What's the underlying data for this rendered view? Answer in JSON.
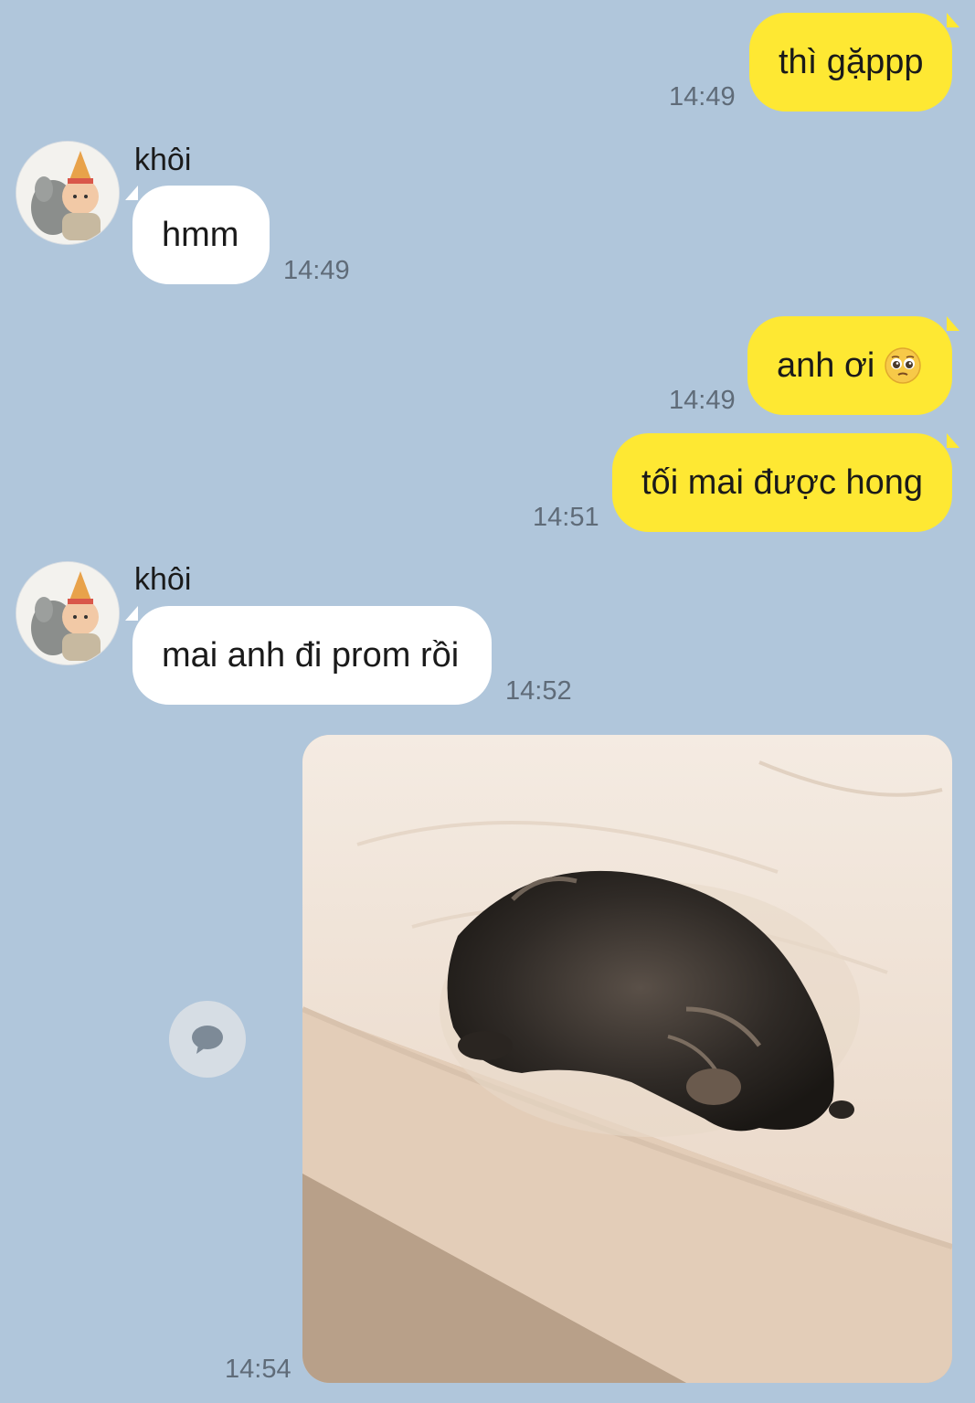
{
  "messages": [
    {
      "side": "me",
      "text": "thì gặppp",
      "time": "14:49"
    },
    {
      "side": "them",
      "sender": "khôi",
      "text": "hmm",
      "time": "14:49"
    },
    {
      "side": "me",
      "text": "anh ơi",
      "emoji": "pleading-face-icon",
      "time": "14:49"
    },
    {
      "side": "me",
      "text": "tối mai được hong",
      "time": "14:51"
    },
    {
      "side": "them",
      "sender": "khôi",
      "text": "mai anh đi prom rồi",
      "time": "14:52"
    },
    {
      "side": "me",
      "type": "image",
      "image": "cat-on-bed-photo",
      "time": "14:54"
    }
  ],
  "colors": {
    "background": "#b0c6db",
    "my_bubble": "#fee833",
    "their_bubble": "#ffffff",
    "timestamp": "#5f6b78"
  },
  "icons": {
    "reply": "speech-bubble-icon"
  }
}
